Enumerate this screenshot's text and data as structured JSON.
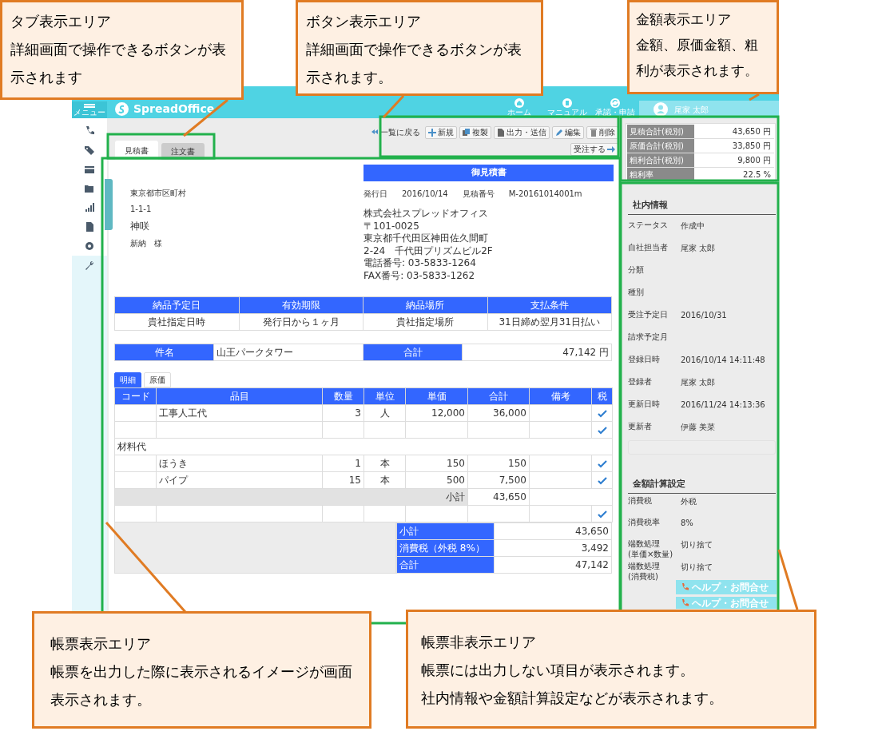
{
  "header": {
    "menu_label": "メニュー",
    "logo": "SpreadOffice",
    "nav_buttons": [
      {
        "label": "ホーム",
        "kind": "home"
      },
      {
        "label": "マニュアル",
        "kind": "manual"
      },
      {
        "label": "承認・申請",
        "kind": "approval"
      }
    ],
    "user": "尾家 太郎"
  },
  "doc_tabs": [
    {
      "label": "見積書",
      "selected": true
    },
    {
      "label": "注文書",
      "selected": false
    }
  ],
  "actions": [
    {
      "label": "一覧に戻る",
      "kind": "back"
    },
    {
      "label": "新規",
      "kind": "new"
    },
    {
      "label": "複製",
      "kind": "copy"
    },
    {
      "label": "出力・送信",
      "kind": "output"
    },
    {
      "label": "編集",
      "kind": "edit"
    },
    {
      "label": "削除",
      "kind": "delete"
    },
    {
      "label": "受注する",
      "kind": "order"
    }
  ],
  "document": {
    "title": "御見積書",
    "customer": [
      "東京都市区町村",
      "1-1-1",
      "神咲",
      "新納　様"
    ],
    "meta": [
      {
        "label": "発行日",
        "value": "2016/10/14"
      },
      {
        "label": "見積番号",
        "value": "M-20161014001m"
      }
    ],
    "company": "株式会社スプレッドオフィス",
    "company_lines": [
      "〒101-0025",
      "東京都千代田区神田佐久間町",
      "2-24　千代田プリズムビル2F",
      "電話番号:  03-5833-1264",
      "FAX番号:  03-5833-1262"
    ],
    "terms": {
      "headers": [
        "納品予定日",
        "有効期限",
        "納品場所",
        "支払条件"
      ],
      "values": [
        "貴社指定日時",
        "発行日から１ヶ月",
        "貴社指定場所",
        "31日締め翌月31日払い"
      ]
    },
    "subject": [
      {
        "label": "件名",
        "value": "山王パークタワー"
      },
      {
        "label": "合計",
        "value": "47,142 円"
      }
    ],
    "detail_tabs": [
      {
        "label": "明細",
        "selected": true
      },
      {
        "label": "原価",
        "selected": false
      }
    ],
    "columns": [
      "コード",
      "品目",
      "数量",
      "単位",
      "単価",
      "合計",
      "備考",
      "税"
    ],
    "rows": [
      {
        "kind": "item",
        "name": "工事人工代",
        "qty": "3",
        "unit": "人",
        "price": "12,000",
        "amount": "36,000",
        "taxed": true
      },
      {
        "kind": "item",
        "taxed": true
      },
      {
        "kind": "section",
        "label": "材料代"
      },
      {
        "kind": "item",
        "name": "ほうき",
        "qty": "1",
        "unit": "本",
        "price": "150",
        "amount": "150",
        "taxed": true
      },
      {
        "kind": "item",
        "name": "パイプ",
        "qty": "15",
        "unit": "本",
        "price": "500",
        "amount": "7,500",
        "taxed": true
      },
      {
        "kind": "subtotal",
        "label": "小計",
        "amount": "43,650"
      },
      {
        "kind": "item",
        "taxed": true
      }
    ],
    "totals": [
      {
        "label": "小計",
        "value": "43,650"
      },
      {
        "label": "消費税（外税 8%）",
        "value": "3,492"
      },
      {
        "label": "合計",
        "value": "47,142"
      }
    ]
  },
  "amounts": [
    {
      "label": "見積合計(税別)",
      "value": "43,650 円"
    },
    {
      "label": "原価合計(税別)",
      "value": "33,850 円"
    },
    {
      "label": "粗利合計(税別)",
      "value": "9,800 円"
    },
    {
      "label": "粗利率",
      "value": "22.5 %"
    }
  ],
  "internal": {
    "title": "社内情報",
    "fields": [
      {
        "label": "ステータス",
        "value": "作成中"
      },
      {
        "label": "自社担当者",
        "value": "尾家 太郎"
      },
      {
        "label": "分類"
      },
      {
        "label": "種別"
      },
      {
        "label": "受注予定日",
        "value": "2016/10/31"
      },
      {
        "label": "請求予定月"
      },
      {
        "label": "登録日時",
        "value": "2016/10/14 14:11:48"
      },
      {
        "label": "登録者",
        "value": "尾家 太郎"
      },
      {
        "label": "更新日時",
        "value": "2016/11/24 14:13:36"
      },
      {
        "label": "更新者",
        "value": "伊藤 美菜"
      }
    ]
  },
  "calc": {
    "title": "金額計算設定",
    "fields": [
      {
        "label": "消費税",
        "value": "外税"
      },
      {
        "label": "消費税率",
        "value": "8%"
      },
      {
        "label": "端数処理\n(単価×数量)",
        "value": "切り捨て"
      },
      {
        "label": "端数処理\n(消費税)",
        "value": "切り捨て"
      }
    ]
  },
  "help_buttons": [
    "ヘルプ・お問合せ",
    "ヘルプ・お問合せ"
  ],
  "callouts": [
    {
      "title": "タブ表示エリア",
      "lines": [
        "詳細画面で操作できるボタンが表示されます"
      ]
    },
    {
      "title": "ボタン表示エリア",
      "lines": [
        "詳細画面で操作できるボタンが表示されます。"
      ]
    },
    {
      "title": "金額表示エリア",
      "lines": [
        "金額、原価金額、粗利が表示されます。"
      ]
    },
    {
      "title": "帳票表示エリア",
      "lines": [
        "帳票を出力した際に表示されるイメージが画面表示されます。"
      ]
    },
    {
      "title": "帳票非表示エリア",
      "lines": [
        "帳票には出力しない項目が表示されます。",
        "社内情報や金額計算設定などが表示されます。"
      ]
    }
  ]
}
